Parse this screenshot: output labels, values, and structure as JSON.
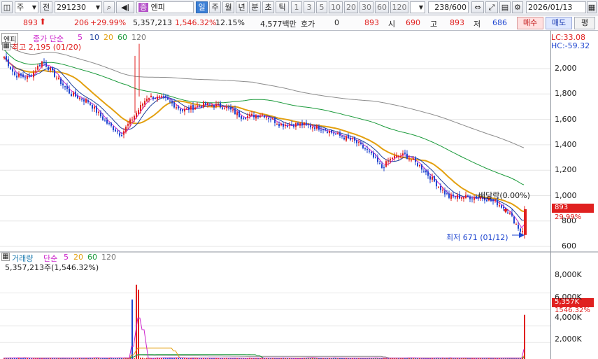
{
  "toolbar": {
    "market_label": "주",
    "prev_label": "전",
    "code": "291230",
    "name_badge": "증",
    "name": "엔피",
    "periods": [
      "일",
      "주",
      "월",
      "년",
      "분",
      "초",
      "틱"
    ],
    "selected_period": "일",
    "minutes": [
      "1",
      "3",
      "5",
      "10",
      "20",
      "30",
      "60",
      "120"
    ],
    "page_counter": "238/600",
    "date": "2026/01/13"
  },
  "quote": {
    "price": "893",
    "change": "206",
    "change_pct": "+29.99%",
    "volume": "5,357,213",
    "volume_ratio": "1,546.32%",
    "turnover": "12.15%",
    "amount": "4,577백만",
    "hoga_label": "호가",
    "hoga_value": "0",
    "current": "893",
    "open_label": "시",
    "open": "690",
    "high_label": "고",
    "high": "893",
    "low_label": "저",
    "low": "686",
    "buy_label": "매수",
    "sell_label": "매도",
    "eval_label": "평"
  },
  "price_panel": {
    "name": "엔피",
    "legend_prefix": "종가 단순",
    "ma": [
      "5",
      "10",
      "20",
      "60",
      "120"
    ],
    "max_label": "최고 2,195 (01/20)",
    "min_label": "최저 671 (01/12)",
    "event_label": "배당락(0.00%)",
    "lc": "LC:33.08",
    "hc": "HC:-59.32",
    "axis": [
      "2,000",
      "1,800",
      "1,600",
      "1,400",
      "1,200",
      "1,000",
      "800",
      "600"
    ],
    "current_tag": "893",
    "pct_tag": "29.99%"
  },
  "volume_panel": {
    "name": "거래량",
    "legend_prefix": "단순",
    "ma": [
      "5",
      "20",
      "60",
      "120"
    ],
    "summary": "5,357,213주(1,546.32%)",
    "axis": [
      "8,000K",
      "6,000K",
      "4,000K",
      "2,000K"
    ],
    "current_tag": "5,357K",
    "pct_tag": "1546.32%"
  },
  "colors": {
    "up": "#e0201f",
    "down": "#1f46d0",
    "ma5": "#cc22cc",
    "ma10": "#1d3f9c",
    "ma20": "#e3a010",
    "ma60": "#1a9a3a",
    "ma120": "#8c8c8c"
  }
}
